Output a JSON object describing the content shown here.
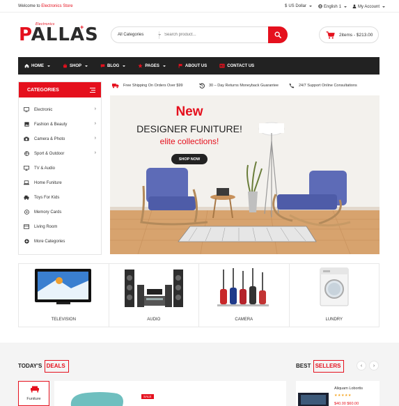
{
  "topbar": {
    "welcome_prefix": "Welcome to ",
    "store_name": "Electronics Store",
    "currency": "US Dollar",
    "language": "English",
    "language_suffix": "1",
    "account": "My Account"
  },
  "logo": {
    "tagline": "Electronics",
    "first_letter": "P",
    "rest": "ALLAS"
  },
  "search": {
    "category": "All Categories",
    "placeholder": "Search product..."
  },
  "cart": {
    "summary": "2items - $213.00"
  },
  "nav": {
    "items": [
      {
        "label": "HOME",
        "icon": "home-icon",
        "dropdown": true
      },
      {
        "label": "SHOP",
        "icon": "shop-icon",
        "dropdown": true
      },
      {
        "label": "BLOG",
        "icon": "blog-icon",
        "dropdown": true
      },
      {
        "label": "PAGES",
        "icon": "star-icon",
        "dropdown": true
      },
      {
        "label": "ABOUT US",
        "icon": "flag-icon",
        "dropdown": false
      },
      {
        "label": "CONTACT US",
        "icon": "card-icon",
        "dropdown": false
      }
    ]
  },
  "categories": {
    "title": "CATEGORIES",
    "items": [
      {
        "label": "Electronic",
        "icon": "monitor-icon",
        "has_sub": true
      },
      {
        "label": "Fashion & Beauty",
        "icon": "image-icon",
        "has_sub": true
      },
      {
        "label": "Camera & Photo",
        "icon": "camera-icon",
        "has_sub": true
      },
      {
        "label": "Sport & Outdoor",
        "icon": "ball-icon",
        "has_sub": true
      },
      {
        "label": "TV & Audio",
        "icon": "tv-icon",
        "has_sub": false
      },
      {
        "label": "Home Funiture",
        "icon": "laptop-icon",
        "has_sub": false
      },
      {
        "label": "Toys For Kids",
        "icon": "toy-icon",
        "has_sub": false
      },
      {
        "label": "Memory Cards",
        "icon": "card-icon",
        "has_sub": false
      },
      {
        "label": "Living Room",
        "icon": "sofa-icon",
        "has_sub": false
      },
      {
        "label": "More Categories",
        "icon": "plus-circle-icon",
        "has_sub": false
      }
    ]
  },
  "services": [
    {
      "label": "Free Shipping On Orders Over $99",
      "icon": "truck-icon"
    },
    {
      "label": "30 – Day Returns Moneyback Guarantee",
      "icon": "return-icon"
    },
    {
      "label": "24/7 Support Online Consultations",
      "icon": "phone-icon"
    }
  ],
  "banner": {
    "new": "New",
    "headline": "DESIGNER FUNITURE!",
    "subline": "elite collections!",
    "cta": "SHOP NOW"
  },
  "product_categories": [
    {
      "label": "TELEVISION"
    },
    {
      "label": "AUDIO"
    },
    {
      "label": "CAMERA"
    },
    {
      "label": "LUNDRY"
    }
  ],
  "deals": {
    "title_prefix": "TODAY'S",
    "title_highlight": "DEALS",
    "tab_label": "Funiture",
    "sale": "SALE"
  },
  "best_sellers": {
    "title_prefix": "BEST",
    "title_highlight": "SELLERS",
    "product_name": "Aliquam Lobortis",
    "stars": "★★★★★",
    "price": "$40.00  $60.00"
  },
  "colors": {
    "accent": "#e5101d",
    "dark": "#222222"
  }
}
